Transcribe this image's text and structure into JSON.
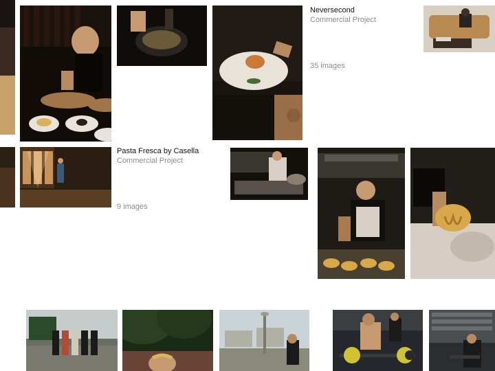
{
  "projects": {
    "neversecond": {
      "title": "Neversecond",
      "subtitle": "Commercial Project",
      "count_label": "35 images"
    },
    "pasta_fresca": {
      "title": "Pasta Fresca by Casella",
      "subtitle": "Commercial Project",
      "count_label": "9 images"
    }
  }
}
